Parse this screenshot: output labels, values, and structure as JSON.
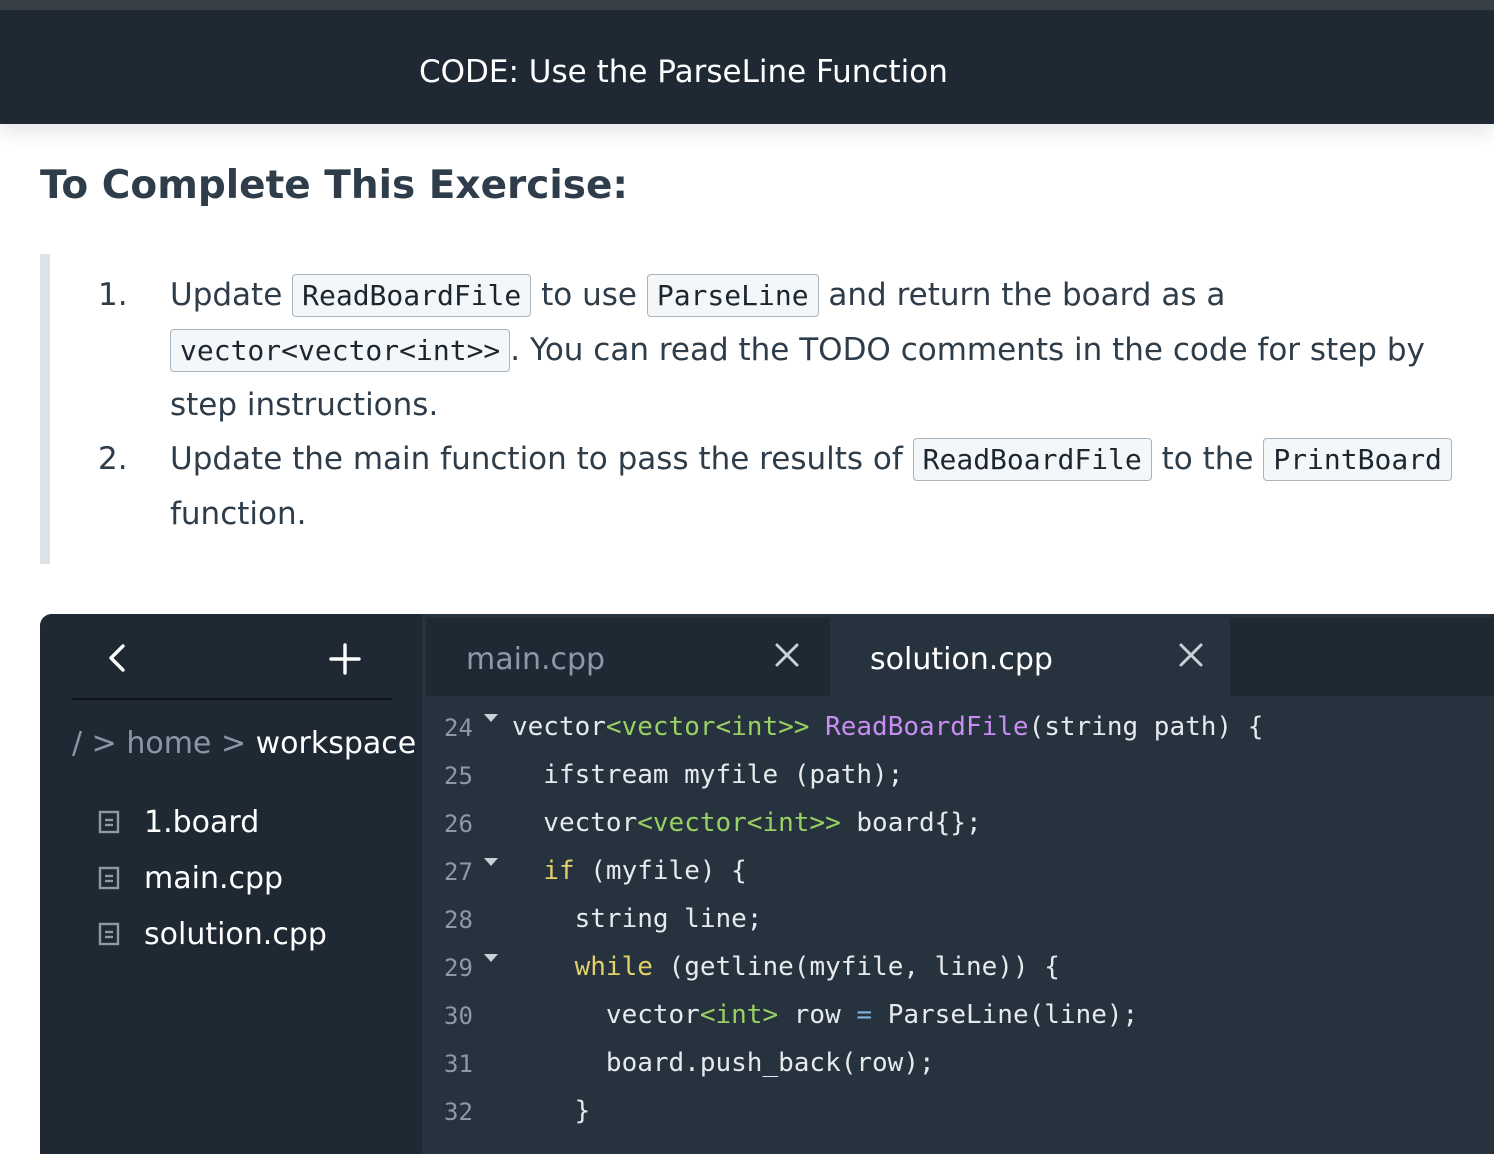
{
  "header": {
    "title": "CODE: Use the ParseLine Function"
  },
  "section": {
    "heading": "To Complete This Exercise:"
  },
  "steps": [
    {
      "number": "1.",
      "t1": "Update ",
      "c1": "ReadBoardFile",
      "t2": " to use ",
      "c2": "ParseLine",
      "t3": " and return the board as a ",
      "c3": "vector<vector<int>>",
      "t4": ". You can read the TODO comments in the code for step by step instructions."
    },
    {
      "number": "2.",
      "t1": "Update the main function to pass the results of ",
      "c1": "ReadBoardFile",
      "t2": " to the ",
      "c2": "PrintBoard",
      "t3": " function."
    }
  ],
  "sidebar": {
    "back_glyph": "<",
    "add_glyph": "+",
    "breadcrumb": {
      "root": "/",
      "sep": ">",
      "home": "home",
      "current": "workspace"
    },
    "files": [
      "1.board",
      "main.cpp",
      "solution.cpp"
    ]
  },
  "tabs": [
    {
      "label": "main.cpp",
      "active": false
    },
    {
      "label": "solution.cpp",
      "active": true
    }
  ],
  "code": {
    "line_numbers": [
      "24",
      "25",
      "26",
      "27",
      "28",
      "29",
      "30",
      "31",
      "32"
    ],
    "folds": [
      true,
      false,
      false,
      true,
      false,
      true,
      false,
      false,
      false
    ],
    "tokens": {
      "l24": [
        "vector",
        "<vector<int>>",
        " ",
        "ReadBoardFile",
        "(string path) {"
      ],
      "l25": [
        "  ifstream myfile (path);"
      ],
      "l26": [
        "  vector",
        "<vector<int>>",
        " board{};"
      ],
      "l27": [
        "  ",
        "if",
        " (myfile) {"
      ],
      "l28": [
        "    string line;"
      ],
      "l29": [
        "    ",
        "while",
        " (getline(myfile, line)) {"
      ],
      "l30": [
        "      vector",
        "<int>",
        " row ",
        "=",
        " ParseLine(line);"
      ],
      "l31": [
        "      board.push_back(row);"
      ],
      "l32": [
        "    }"
      ]
    }
  },
  "colors": {
    "header_bg": "#1e2933",
    "ide_bg": "#1e2933",
    "editor_bg": "#26323d",
    "keyword": "#e2cf6b",
    "type": "#9ad063",
    "function": "#c88cf2"
  }
}
